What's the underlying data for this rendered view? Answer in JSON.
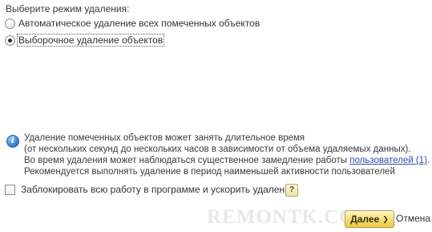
{
  "deletion_mode": {
    "title": "Выберите режим удаления:",
    "options": [
      {
        "label": "Автоматическое удаление всех помеченных объектов",
        "checked": false
      },
      {
        "label": "Выборочное удаление объектов",
        "checked": true
      }
    ]
  },
  "info": {
    "icon": "info-icon",
    "line1": "Удаление помеченных объектов может занять длительное время",
    "line2": "(от нескольких секунд до нескольких часов в зависимости от объема удаляемых данных).",
    "line3_prefix": "Во время удаления может наблюдаться существенное замедление работы ",
    "line3_link": "пользователей (1)",
    "line3_suffix": ".",
    "line4": "Рекомендуется выполнять удаление в период наименьшей активности пользователей"
  },
  "lock_option": {
    "label": "Заблокировать всю работу в программе и ускорить удаление",
    "checked": false,
    "help_label": "?"
  },
  "watermark": "REMONTK.COM",
  "buttons": {
    "next": "Далее",
    "cancel": "Отмена"
  },
  "colors": {
    "link": "#2c4fa8",
    "primary_button": "#f6df7a",
    "info_icon": "#3e8ad8"
  }
}
